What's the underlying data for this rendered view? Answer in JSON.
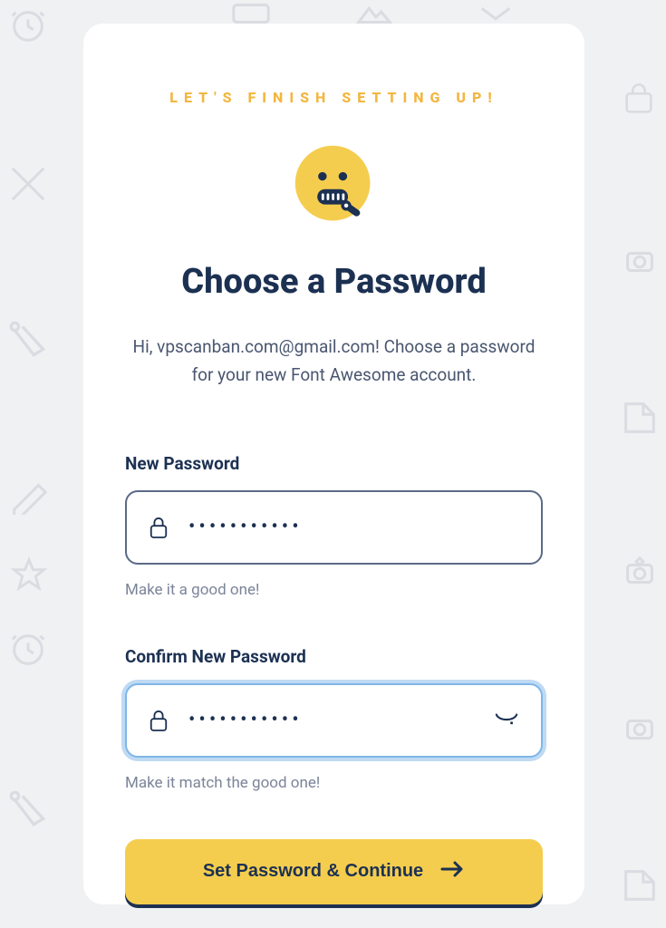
{
  "eyebrow": "LET'S FINISH SETTING UP!",
  "title": "Choose a Password",
  "subtitle": "Hi, vpscanban.com@gmail.com! Choose a password for your new Font Awesome account.",
  "fields": {
    "new_password": {
      "label": "New Password",
      "value": "•••••••••••",
      "hint": "Make it a good one!"
    },
    "confirm_password": {
      "label": "Confirm New Password",
      "value": "•••••••••••",
      "hint": "Make it match the good one!"
    }
  },
  "submit_label": "Set Password & Continue",
  "colors": {
    "accent": "#f5cd4e",
    "text_dark": "#1c3152",
    "eyebrow": "#f3b63f",
    "focus_ring": "#7fb6e8"
  }
}
